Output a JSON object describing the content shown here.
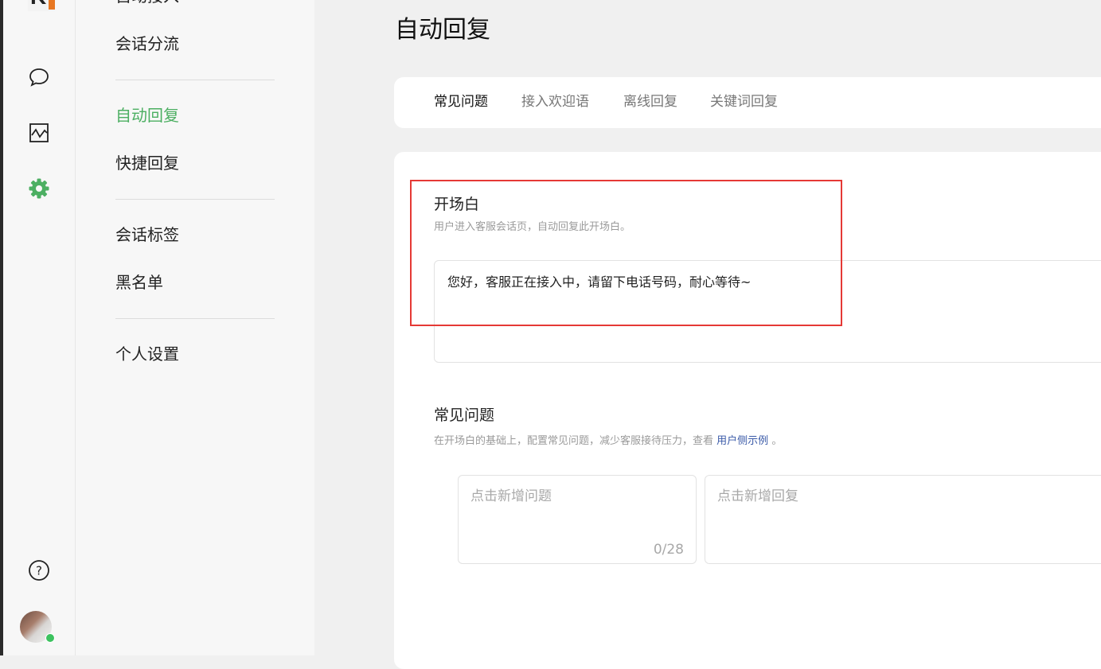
{
  "app": {
    "logo_letter": "K",
    "brand_colors": {
      "accent_green": "#4caf62",
      "logo_orange": "#e87722",
      "highlight_red": "#e53935"
    }
  },
  "rail": {
    "icons": [
      "chat-bubble-icon",
      "analytics-chart-icon",
      "settings-gear-icon",
      "help-question-icon"
    ],
    "avatar_status": "online"
  },
  "menu": {
    "items": [
      {
        "label": "自动接入"
      },
      {
        "label": "会话分流"
      },
      {
        "label": "自动回复",
        "active": true
      },
      {
        "label": "快捷回复"
      },
      {
        "label": "会话标签"
      },
      {
        "label": "黑名单"
      },
      {
        "label": "个人设置"
      }
    ]
  },
  "page": {
    "title": "自动回复",
    "tabs": [
      {
        "label": "常见问题",
        "active": true
      },
      {
        "label": "接入欢迎语"
      },
      {
        "label": "离线回复"
      },
      {
        "label": "关键词回复"
      }
    ]
  },
  "opening": {
    "title": "开场白",
    "description": "用户进入客服会话页，自动回复此开场白。",
    "value": "您好，客服正在接入中，请留下电话号码，耐心等待~"
  },
  "faq": {
    "title": "常见问题",
    "description_prefix": "在开场白的基础上，配置常见问题，减少客服接待压力，查看",
    "link_label": "用户侧示例",
    "description_suffix": "。",
    "question_placeholder": "点击新增问题",
    "question_counter": "0/28",
    "reply_placeholder": "点击新增回复"
  }
}
